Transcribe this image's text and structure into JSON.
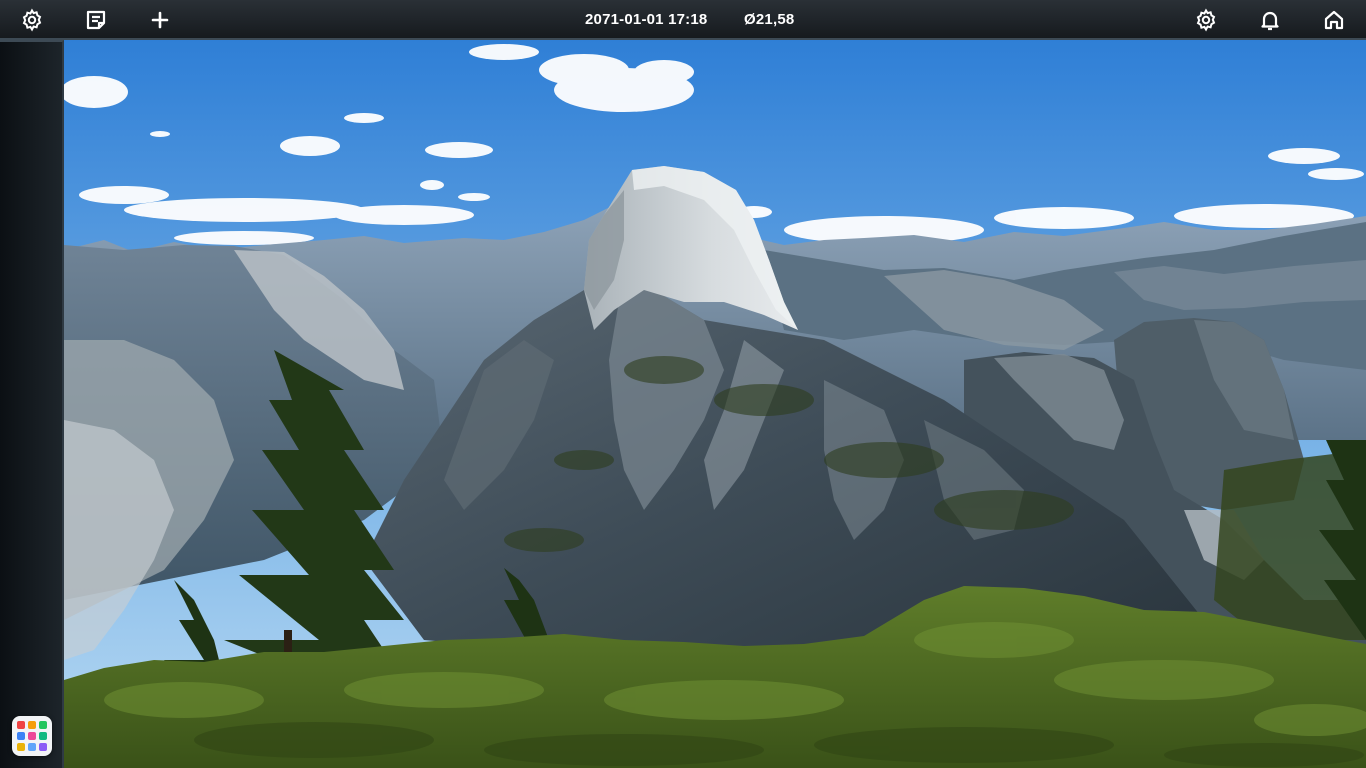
{
  "topbar": {
    "datetime": "2071-01-01 17:18",
    "balance": "Ø21,58",
    "left_icons": [
      "settings-icon",
      "notes-icon",
      "add-icon"
    ],
    "right_icons": [
      "settings-icon",
      "notifications-icon",
      "home-icon"
    ]
  },
  "dock": {
    "launcher_icon": "app-grid-icon",
    "launcher_tile_colors": [
      "#ef4444",
      "#f59e0b",
      "#22c55e",
      "#3b82f6",
      "#ec4899",
      "#10b981",
      "#eab308",
      "#60a5fa",
      "#8b5cf6"
    ]
  },
  "wallpaper": {
    "subject": "mountain-landscape",
    "colors": {
      "sky_top": "#2f7fd6",
      "sky_bottom": "#b9daf3",
      "rock": "#6f7c86",
      "dome": "#c9cfd3",
      "forest": "#4f6a22"
    }
  },
  "colors": {
    "bar": "#1d2227",
    "bar_border": "#3d4a55",
    "text": "#ffffff"
  }
}
